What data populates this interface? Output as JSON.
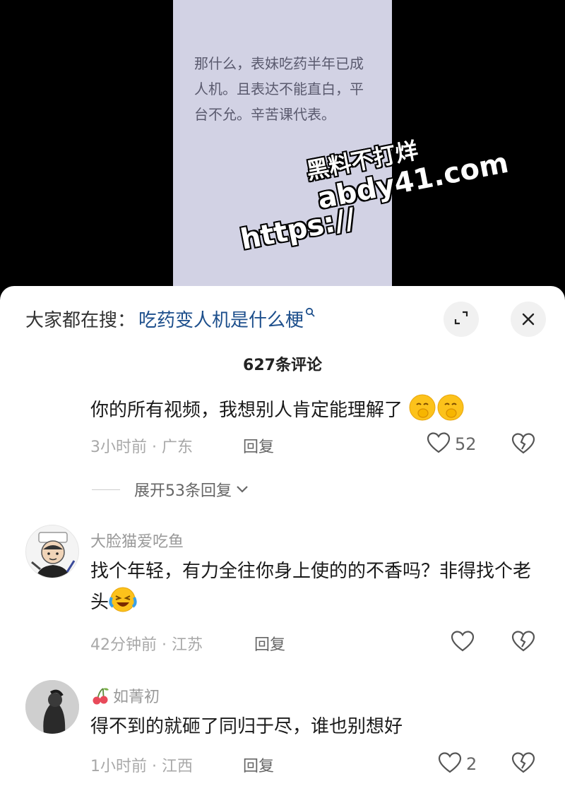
{
  "video": {
    "caption": "那什么，表妹吃药半年已成人机。且表达不能直白，平台不允。辛苦课代表。",
    "watermark": {
      "line1": "黑料不打烊",
      "line2": "abdy41.com",
      "line3": "https://"
    }
  },
  "search": {
    "prefix": "大家都在搜：",
    "query": "吃药变人机是什么梗",
    "query_icon": "search-icon"
  },
  "header": {
    "comment_count": "627条评论",
    "expand_icon": "expand-icon",
    "close_icon": "close-icon"
  },
  "comments": [
    {
      "text": "你的所有视频，我想别人肯定能理解了",
      "emoji": [
        "shushing-face-emoji",
        "shushing-face-emoji"
      ],
      "time": "3小时前",
      "location": "广东",
      "reply_label": "回复",
      "likes": "52",
      "expand_replies": "展开53条回复"
    },
    {
      "author": "大脸猫爱吃鱼",
      "text": "找个年轻，有力全往你身上使的的不香吗？非得找个老头",
      "emoji": [
        "laughing-crying-emoji"
      ],
      "time": "42分钟前",
      "location": "江苏",
      "reply_label": "回复",
      "likes": ""
    },
    {
      "author": "如菁初",
      "author_badge": "cherry-icon",
      "text": "得不到的就砸了同归于尽，谁也别想好",
      "time": "1小时前",
      "location": "江西",
      "reply_label": "回复",
      "likes": "2"
    }
  ],
  "colors": {
    "video_frame": "#d2d2e4",
    "link_blue": "#1d4f8c",
    "meta_gray": "#a8a8a8"
  }
}
